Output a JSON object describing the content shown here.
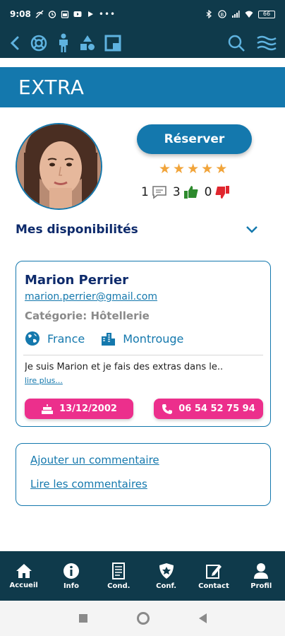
{
  "status_bar": {
    "time": "9:08",
    "battery": "66",
    "icons": [
      "signal-off-icon",
      "alarm-icon",
      "calendar-icon",
      "youtube-icon",
      "play-icon",
      "more-icon",
      "bluetooth-icon",
      "sync-icon",
      "cell-signal-icon",
      "wifi-icon",
      "battery-icon"
    ]
  },
  "app_bar": {
    "icons": [
      "back-icon",
      "lifebuoy-icon",
      "person-icon",
      "shapes-icon",
      "square-icon",
      "search-icon",
      "waves-icon"
    ]
  },
  "header": {
    "title": "EXTRA"
  },
  "profile": {
    "reserve_label": "Réserver",
    "rating": 5,
    "comments_count": "1",
    "likes_count": "3",
    "dislikes_count": "0"
  },
  "availability": {
    "label": "Mes disponibilités"
  },
  "person": {
    "name": "Marion Perrier",
    "email": "marion.perrier@gmail.com",
    "category": "Catégorie: Hôtellerie",
    "country": "France",
    "city": "Montrouge",
    "bio": "Je suis Marion et je fais des extras dans le..",
    "read_more": "lire plus...",
    "birthdate": "13/12/2002",
    "phone": "06 54 52 75 94"
  },
  "comments": {
    "add": "Ajouter un commentaire",
    "read": "Lire les commentaires"
  },
  "bottom_nav": [
    {
      "label": "Accueil",
      "icon": "home-icon"
    },
    {
      "label": "Info",
      "icon": "info-icon"
    },
    {
      "label": "Cond.",
      "icon": "document-icon"
    },
    {
      "label": "Conf.",
      "icon": "shield-icon"
    },
    {
      "label": "Contact",
      "icon": "edit-icon"
    },
    {
      "label": "Profil",
      "icon": "profile-icon"
    }
  ],
  "colors": {
    "primary": "#1478ad",
    "dark": "#0f3a4b",
    "accent": "#ec2f8c",
    "star": "#f1a43a",
    "thumb_up": "#2d8a2d",
    "thumb_down": "#e0262e"
  }
}
